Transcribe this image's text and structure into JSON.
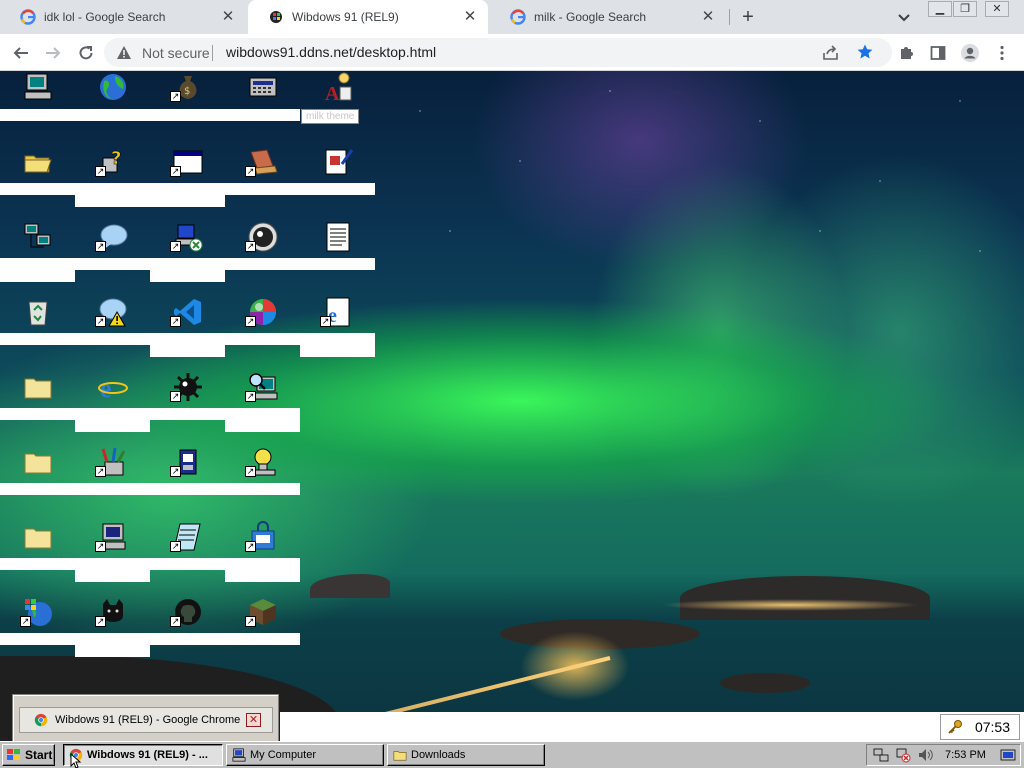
{
  "browser": {
    "tabs": [
      {
        "title": "idk lol - Google Search",
        "active": false
      },
      {
        "title": "Wibdows 91 (REL9)",
        "active": true
      },
      {
        "title": "milk - Google Search",
        "active": false
      }
    ],
    "security_label": "Not secure",
    "url": "wibdows91.ddns.net/desktop.html"
  },
  "desktop": {
    "tooltip": "milk theme",
    "wallpaper": "aurora-over-fjord"
  },
  "preview": {
    "item_label": "Wibdows 91 (REL9) - Google Chrome"
  },
  "clock_widget": {
    "time": "07:53"
  },
  "taskbar": {
    "start_label": "Start",
    "tasks": [
      {
        "label": "Wibdows 91 (REL9) - ...",
        "pressed": true
      },
      {
        "label": "My Computer",
        "pressed": false
      },
      {
        "label": "Downloads",
        "pressed": false
      }
    ],
    "tray_time": "7:53 PM"
  },
  "colors": {
    "chrome_accent": "#1a73e8",
    "taskbar_gray": "#c0c0c0"
  }
}
